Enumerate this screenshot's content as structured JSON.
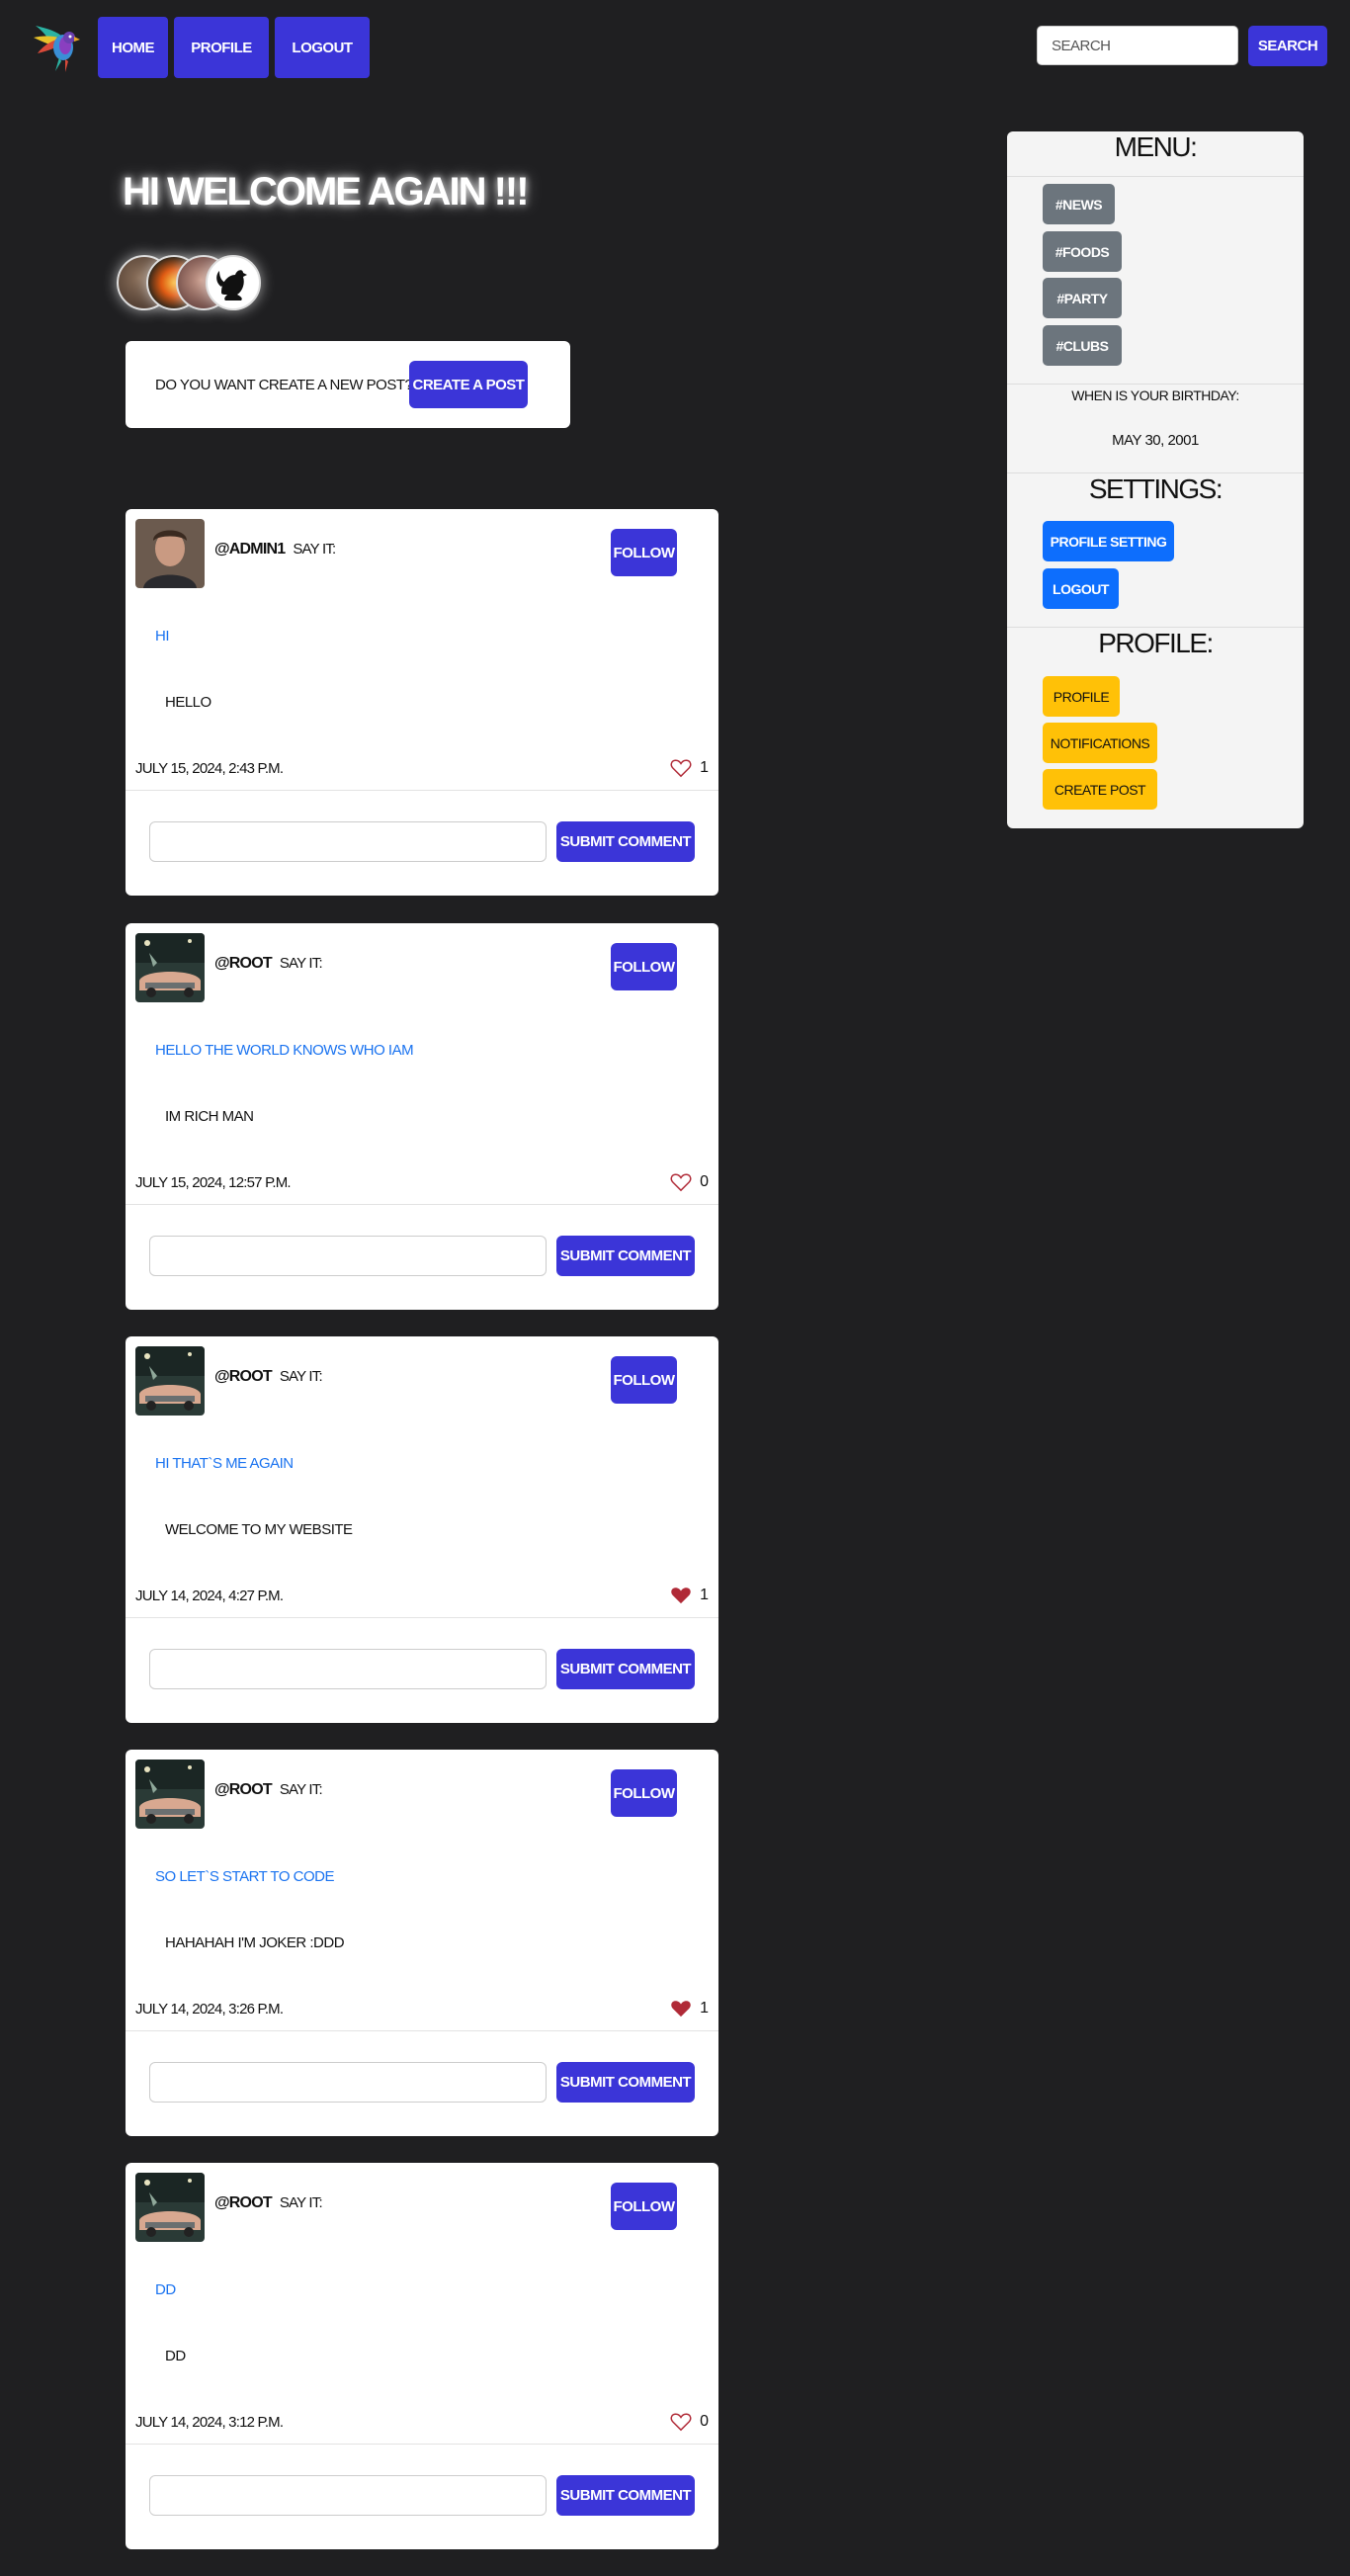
{
  "nav": {
    "logo": "parrot-logo",
    "home": "Home",
    "profile": "Profile",
    "logout": "Logout",
    "search_placeholder": "Search",
    "search_button": "Search"
  },
  "welcome": "Hi welcome again !!!",
  "create_prompt": "Do you want create a new post??",
  "create_button": "Create a post",
  "posts": [
    {
      "author": "@admin1",
      "say": "Say it:",
      "follow": "Follow",
      "title": "Hi",
      "body": "Hello",
      "date": "July 15, 2024, 2:43 p.m.",
      "likes": "1",
      "liked": false,
      "submit": "Submit comment"
    },
    {
      "author": "@root",
      "say": "Say it:",
      "follow": "Follow",
      "title": "Hello the world knows who iam",
      "body": "Im rich man",
      "date": "July 15, 2024, 12:57 p.m.",
      "likes": "0",
      "liked": false,
      "submit": "Submit comment"
    },
    {
      "author": "@root",
      "say": "Say it:",
      "follow": "Follow",
      "title": "Hi that`s me again",
      "body": "welcome to my website",
      "date": "July 14, 2024, 4:27 p.m.",
      "likes": "1",
      "liked": true,
      "submit": "Submit comment"
    },
    {
      "author": "@root",
      "say": "Say it:",
      "follow": "Follow",
      "title": "so let`s start to code",
      "body": "Hahahah I'm joker :DDD",
      "date": "July 14, 2024, 3:26 p.m.",
      "likes": "1",
      "liked": true,
      "submit": "Submit comment"
    },
    {
      "author": "@root",
      "say": "Say it:",
      "follow": "Follow",
      "title": "DD",
      "body": "DD",
      "date": "July 14, 2024, 3:12 p.m.",
      "likes": "0",
      "liked": false,
      "submit": "Submit comment"
    }
  ],
  "sidebar": {
    "menu_title": "Menu:",
    "tags": [
      "#news",
      "#foods",
      "#party",
      "#clubs"
    ],
    "birthday_label": "When is your birthday:",
    "birthday_value": "May 30, 2001",
    "settings_title": "Settings:",
    "profile_setting": "Profile Setting",
    "logout": "Logout",
    "profile_title": "Profile:",
    "profile": "Profile",
    "notifications": "Notifications",
    "create_post": "Create Post"
  },
  "colors": {
    "accent": "#3b35d8",
    "link": "#1a73f0",
    "liked": "#b02a37",
    "background": "#1f1f21"
  }
}
